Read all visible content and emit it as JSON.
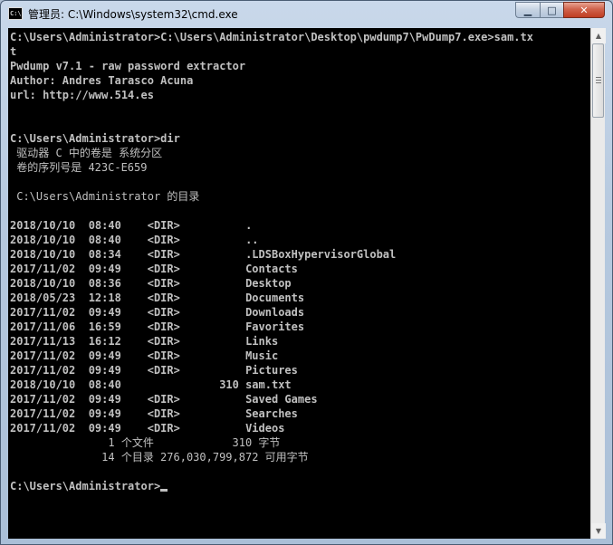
{
  "window": {
    "title": "管理员: C:\\Windows\\system32\\cmd.exe",
    "icon": "cmd-console-icon",
    "icon_text": "C:\\"
  },
  "caption_buttons": {
    "minimize_glyph": "▁",
    "maximize_glyph": "□",
    "close_glyph": "✕"
  },
  "console": {
    "text_color": "#c0c0c0",
    "background": "#000000",
    "lines": [
      "C:\\Users\\Administrator>C:\\Users\\Administrator\\Desktop\\pwdump7\\PwDump7.exe>sam.tx",
      "t",
      "Pwdump v7.1 - raw password extractor",
      "Author: Andres Tarasco Acuna",
      "url: http://www.514.es",
      "",
      "",
      "C:\\Users\\Administrator>dir",
      " 驱动器 C 中的卷是 系统分区",
      " 卷的序列号是 423C-E659",
      "",
      " C:\\Users\\Administrator 的目录",
      "",
      "2018/10/10  08:40    <DIR>          .",
      "2018/10/10  08:40    <DIR>          ..",
      "2018/10/10  08:34    <DIR>          .LDSBoxHypervisorGlobal",
      "2017/11/02  09:49    <DIR>          Contacts",
      "2018/10/10  08:36    <DIR>          Desktop",
      "2018/05/23  12:18    <DIR>          Documents",
      "2017/11/02  09:49    <DIR>          Downloads",
      "2017/11/06  16:59    <DIR>          Favorites",
      "2017/11/13  16:12    <DIR>          Links",
      "2017/11/02  09:49    <DIR>          Music",
      "2017/11/02  09:49    <DIR>          Pictures",
      "2018/10/10  08:40               310 sam.txt",
      "2017/11/02  09:49    <DIR>          Saved Games",
      "2017/11/02  09:49    <DIR>          Searches",
      "2017/11/02  09:49    <DIR>          Videos",
      "               1 个文件            310 字节",
      "              14 个目录 276,030,799,872 可用字节",
      "",
      "C:\\Users\\Administrator>"
    ]
  }
}
